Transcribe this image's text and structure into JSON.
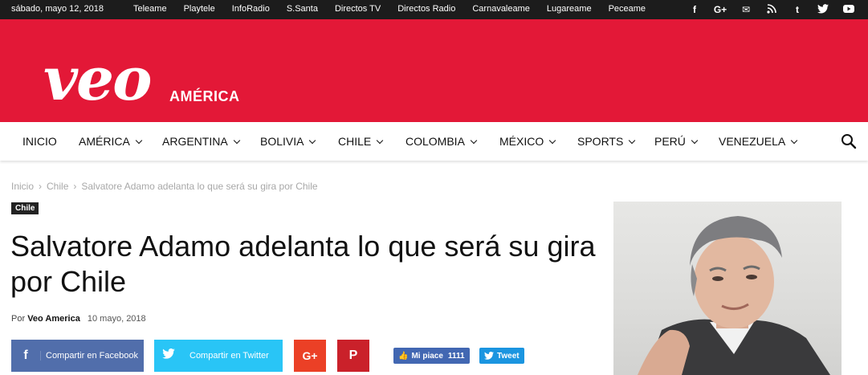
{
  "topbar": {
    "date": "sábado, mayo 12, 2018",
    "links": [
      "Teleame",
      "Playtele",
      "InfoRadio",
      "S.Santa",
      "Directos TV",
      "Directos Radio",
      "Carnavaleame",
      "Lugareame",
      "Peceame"
    ],
    "social": [
      "facebook-icon",
      "google-plus-icon",
      "mail-icon",
      "rss-icon",
      "tumblr-icon",
      "twitter-icon",
      "youtube-icon"
    ]
  },
  "header": {
    "logo_text": "veo",
    "logo_sub": "AMÉRICA",
    "bg_color": "#e31837"
  },
  "nav": {
    "items": [
      {
        "label": "INICIO",
        "dropdown": false
      },
      {
        "label": "AMÉRICA",
        "dropdown": true
      },
      {
        "label": "ARGENTINA",
        "dropdown": true
      },
      {
        "label": "BOLIVIA",
        "dropdown": true
      },
      {
        "label": "CHILE",
        "dropdown": true
      },
      {
        "label": "COLOMBIA",
        "dropdown": true
      },
      {
        "label": "MÉXICO",
        "dropdown": true
      },
      {
        "label": "SPORTS",
        "dropdown": true
      },
      {
        "label": "PERÚ",
        "dropdown": true
      },
      {
        "label": "VENEZUELA",
        "dropdown": true
      }
    ]
  },
  "breadcrumb": {
    "home": "Inicio",
    "section": "Chile",
    "current": "Salvatore Adamo adelanta lo que será su gira por Chile"
  },
  "article": {
    "category": "Chile",
    "title": "Salvatore Adamo adelanta lo que será su gira por Chile",
    "by_prefix": "Por",
    "author": "Veo America",
    "date": "10 mayo, 2018"
  },
  "share": {
    "facebook": "Compartir en Facebook",
    "twitter": "Compartir en Twitter",
    "like_label": "Mi piace",
    "like_count": "1111",
    "tweet_label": "Tweet"
  }
}
